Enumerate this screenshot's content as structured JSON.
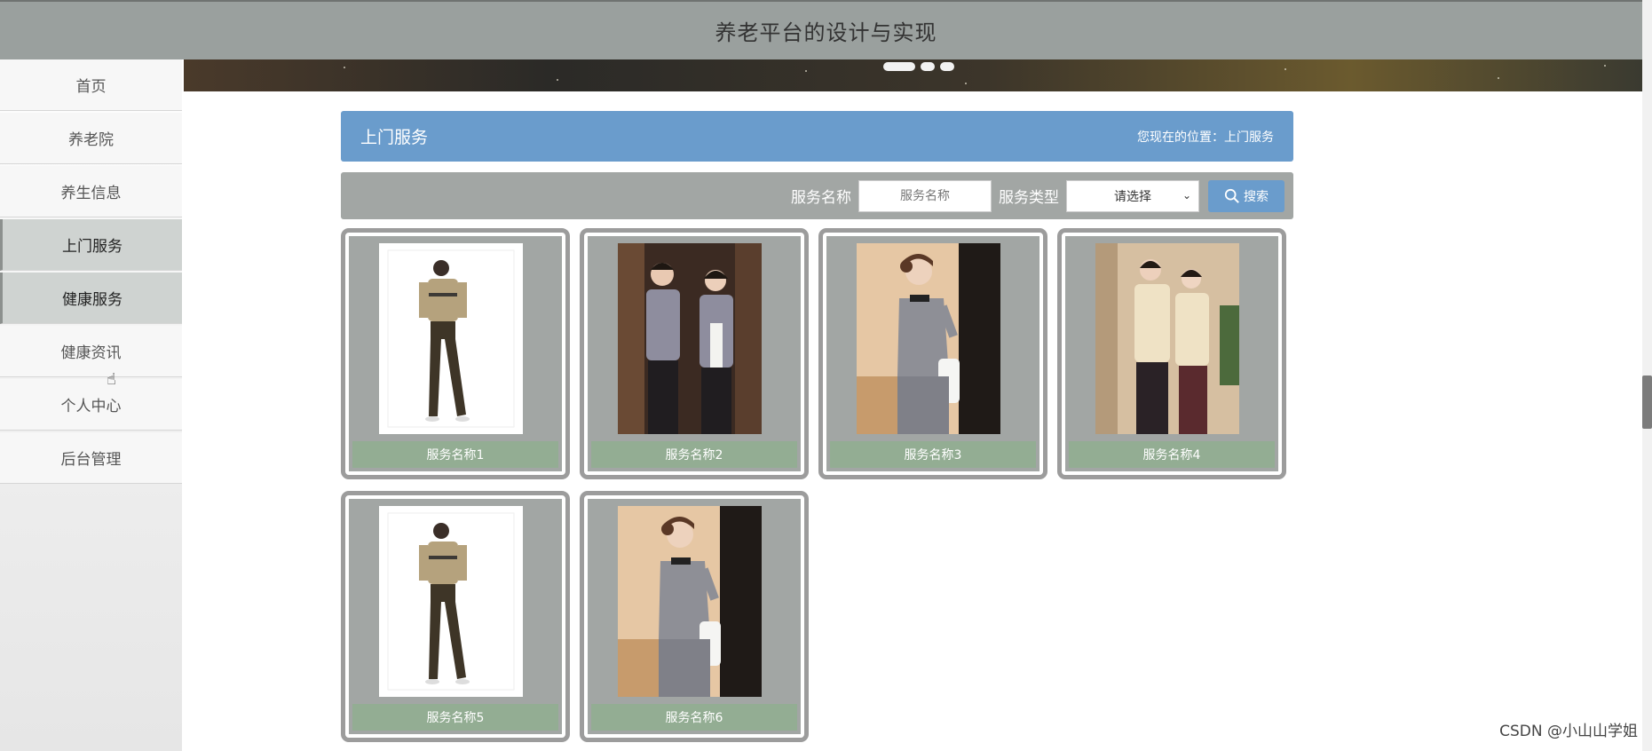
{
  "header": {
    "title": "养老平台的设计与实现"
  },
  "sidebar": {
    "items": [
      {
        "label": "首页",
        "active": false
      },
      {
        "label": "养老院",
        "active": false
      },
      {
        "label": "养生信息",
        "active": false
      },
      {
        "label": "上门服务",
        "active": true
      },
      {
        "label": "健康服务",
        "active": true
      },
      {
        "label": "健康资讯",
        "active": false
      },
      {
        "label": "个人中心",
        "active": false
      },
      {
        "label": "后台管理",
        "active": false
      }
    ]
  },
  "section": {
    "title": "上门服务",
    "breadcrumb": "您现在的位置：上门服务"
  },
  "search": {
    "name_label": "服务名称",
    "name_placeholder": "服务名称",
    "type_label": "服务类型",
    "type_selected": "请选择",
    "button_label": "搜索"
  },
  "cards": [
    {
      "name": "服务名称1",
      "image": "man-standing-uniform"
    },
    {
      "name": "服务名称2",
      "image": "couple-grey-uniforms"
    },
    {
      "name": "服务名称3",
      "image": "woman-grey-uniform-towel"
    },
    {
      "name": "服务名称4",
      "image": "couple-beige-uniforms"
    },
    {
      "name": "服务名称5",
      "image": "man-standing-uniform"
    },
    {
      "name": "服务名称6",
      "image": "woman-grey-uniform-towel"
    }
  ],
  "watermark": "CSDN @小山山学姐"
}
